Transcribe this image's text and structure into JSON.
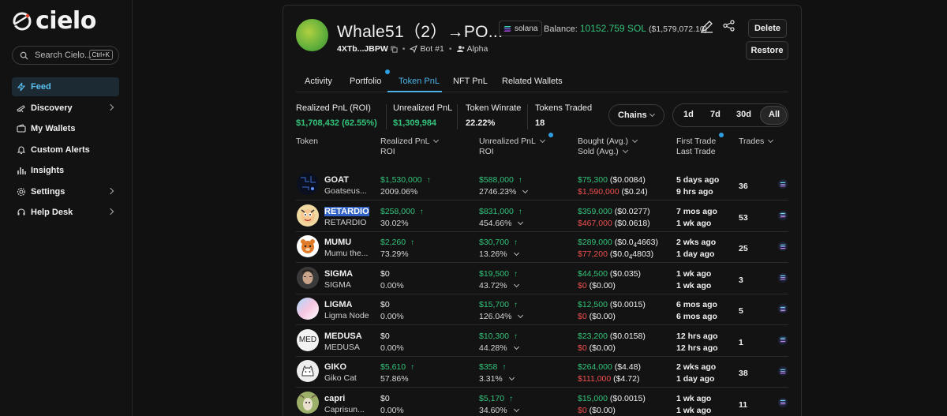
{
  "app": {
    "logo_text": "cielo",
    "search": {
      "placeholder": "Search Cielo...",
      "shortcut": "Ctrl+K"
    },
    "nav": [
      {
        "label": "Feed",
        "icon": "bolt-icon",
        "active": true
      },
      {
        "label": "Discovery",
        "icon": "telescope-icon"
      },
      {
        "label": "My Wallets",
        "icon": "wallet-icon"
      },
      {
        "label": "Custom Alerts",
        "icon": "bell-icon"
      },
      {
        "label": "Insights",
        "icon": "bar-chart-icon"
      },
      {
        "label": "Settings",
        "icon": "gear-icon"
      },
      {
        "label": "Help Desk",
        "icon": "headset-icon"
      }
    ]
  },
  "wallet": {
    "name": "Whale51（2）→PO...",
    "chain": "solana",
    "balance_label": "Balance:",
    "balance_sol": "10152.759 SOL",
    "balance_usd": "($1,579,072.10)",
    "address": "4XTb...JBPW",
    "bot": "Bot #1",
    "tier": "Alpha",
    "delete_label": "Delete",
    "restore_label": "Restore"
  },
  "tabs": [
    "Activity",
    "Portfolio",
    "Token PnL",
    "NFT PnL",
    "Related Wallets"
  ],
  "stats": [
    {
      "label": "Realized PnL (ROI)",
      "value": "$1,708,432 (62.55%)",
      "color": "#33c37a"
    },
    {
      "label": "Unrealized PnL",
      "value": "$1,309,984",
      "color": "#33c37a"
    },
    {
      "label": "Token Winrate",
      "value": "22.22%",
      "color": "#f0f0f0"
    },
    {
      "label": "Tokens Traded",
      "value": "18",
      "color": "#f0f0f0"
    }
  ],
  "filters": {
    "chains_label": "Chains",
    "periods": [
      "1d",
      "7d",
      "30d",
      "All"
    ],
    "active_period": "All"
  },
  "table": {
    "headers": {
      "token": "Token",
      "realized_1": "Realized PnL",
      "realized_2": "ROI",
      "unrealized_1": "Unrealized PnL",
      "unrealized_2": "ROI",
      "bought": "Bought (Avg.)",
      "sold": "Sold (Avg.)",
      "first": "First Trade",
      "last": "Last Trade",
      "trades": "Trades"
    },
    "rows": [
      {
        "symbol": "GOAT",
        "name": "Goatseus...",
        "realized": "$1,530,000",
        "realized_roi": "2009.06%",
        "unrealized": "$588,000",
        "unrealized_roi": "2746.23%",
        "bought": "$75,300",
        "bought_avg": "($0.0084)",
        "sold": "$1,590,000",
        "sold_avg": "($0.24)",
        "first": "5 days ago",
        "last": "9 hrs ago",
        "trades": "36",
        "realized_color": "green",
        "avatar": "dark-circuit"
      },
      {
        "symbol": "RETARDIO",
        "name": "RETARDIO",
        "realized": "$258,000",
        "realized_roi": "30.02%",
        "unrealized": "$831,000",
        "unrealized_roi": "454.66%",
        "bought": "$359,000",
        "bought_avg": "($0.0277)",
        "sold": "$467,000",
        "sold_avg": "($0.0618)",
        "first": "7 mos ago",
        "last": "1 wk ago",
        "trades": "53",
        "realized_color": "green",
        "avatar": "cartoon",
        "highlight": true
      },
      {
        "symbol": "MUMU",
        "name": "Mumu the...",
        "realized": "$2,260",
        "realized_roi": "73.29%",
        "unrealized": "$30,700",
        "unrealized_roi": "13.26%",
        "bought": "$289,000",
        "bought_avg_pre": "($0.0",
        "bought_avg_sub": "4",
        "bought_avg_post": "4663)",
        "sold": "$77,200",
        "sold_avg_pre": "($0.0",
        "sold_avg_sub": "4",
        "sold_avg_post": "4803)",
        "first": "2 wks ago",
        "last": "1 day ago",
        "trades": "25",
        "realized_color": "green",
        "avatar": "bear"
      },
      {
        "symbol": "SIGMA",
        "name": "SIGMA",
        "realized": "$0",
        "realized_roi": "0.00%",
        "unrealized": "$19,500",
        "unrealized_roi": "43.72%",
        "bought": "$44,500",
        "bought_avg": "($0.035)",
        "sold": "$0",
        "sold_avg": "($0.00)",
        "first": "1 wk ago",
        "last": "1 wk ago",
        "trades": "3",
        "realized_color": "white",
        "avatar": "face"
      },
      {
        "symbol": "LIGMA",
        "name": "Ligma Node",
        "realized": "$0",
        "realized_roi": "0.00%",
        "unrealized": "$15,700",
        "unrealized_roi": "126.04%",
        "bought": "$12,500",
        "bought_avg": "($0.0015)",
        "sold": "$0",
        "sold_avg": "($0.00)",
        "first": "6 mos ago",
        "last": "6 mos ago",
        "trades": "5",
        "realized_color": "white",
        "avatar": "pastel"
      },
      {
        "symbol": "MEDUSA",
        "name": "MEDUSA",
        "realized": "$0",
        "realized_roi": "0.00%",
        "unrealized": "$10,300",
        "unrealized_roi": "44.28%",
        "bought": "$23,200",
        "bought_avg": "($0.0158)",
        "sold": "$0",
        "sold_avg": "($0.00)",
        "first": "12 hrs ago",
        "last": "12 hrs ago",
        "trades": "1",
        "realized_color": "white",
        "avatar": "med",
        "avatar_text": "MED"
      },
      {
        "symbol": "GIKO",
        "name": "Giko Cat",
        "realized": "$5,610",
        "realized_roi": "57.86%",
        "unrealized": "$358",
        "unrealized_roi": "3.31%",
        "bought": "$264,000",
        "bought_avg": "($4.48)",
        "sold": "$111,000",
        "sold_avg": "($4.72)",
        "first": "2 wks ago",
        "last": "1 day ago",
        "trades": "38",
        "realized_color": "green",
        "avatar": "cat"
      },
      {
        "symbol": "capri",
        "name": "Caprisun...",
        "realized": "$0",
        "realized_roi": "0.00%",
        "unrealized": "$5,170",
        "unrealized_roi": "34.60%",
        "bought": "$15,000",
        "bought_avg": "($0.0015)",
        "sold": "$0",
        "sold_avg": "($0.00)",
        "first": "1 wk ago",
        "last": "1 wk ago",
        "trades": "11",
        "realized_color": "white",
        "avatar": "goat"
      }
    ]
  }
}
